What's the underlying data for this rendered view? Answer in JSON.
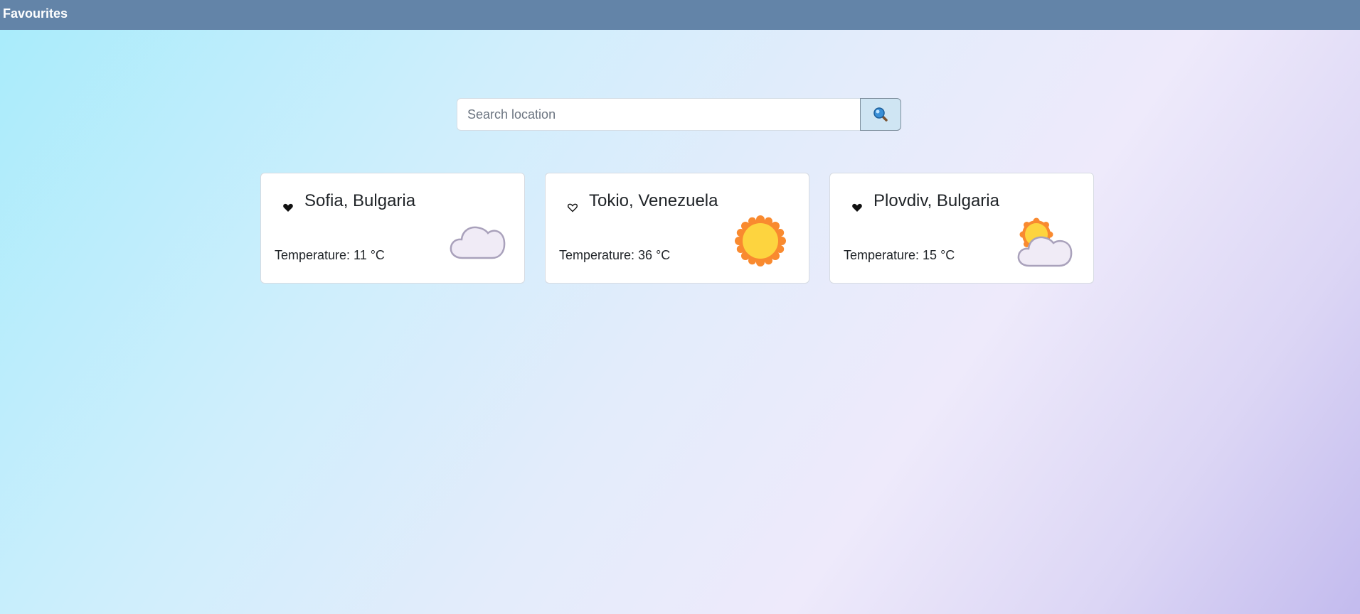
{
  "navbar": {
    "favourites_label": "Favourites"
  },
  "search": {
    "placeholder": "Search location",
    "value": "",
    "button_icon": "search-icon"
  },
  "cards": [
    {
      "location": "Sofia, Bulgaria",
      "temperature_label": "Temperature: 11 °C",
      "favourite": true,
      "favourite_icon": "heart-filled-icon",
      "weather_icon": "cloud-icon"
    },
    {
      "location": "Tokio, Venezuela",
      "temperature_label": "Temperature: 36 °C",
      "favourite": false,
      "favourite_icon": "heart-outline-icon",
      "weather_icon": "sun-icon"
    },
    {
      "location": "Plovdiv, Bulgaria",
      "temperature_label": "Temperature: 15 °C",
      "favourite": true,
      "favourite_icon": "heart-filled-icon",
      "weather_icon": "partly-cloudy-icon"
    }
  ],
  "colors": {
    "navbar": "#6384a8",
    "sun_core": "#fdd43f",
    "sun_rays": "#f98a2f",
    "cloud_fill": "#f0ebf6",
    "cloud_stroke": "#a9a1bb",
    "search_button": "#cfe5f3"
  }
}
